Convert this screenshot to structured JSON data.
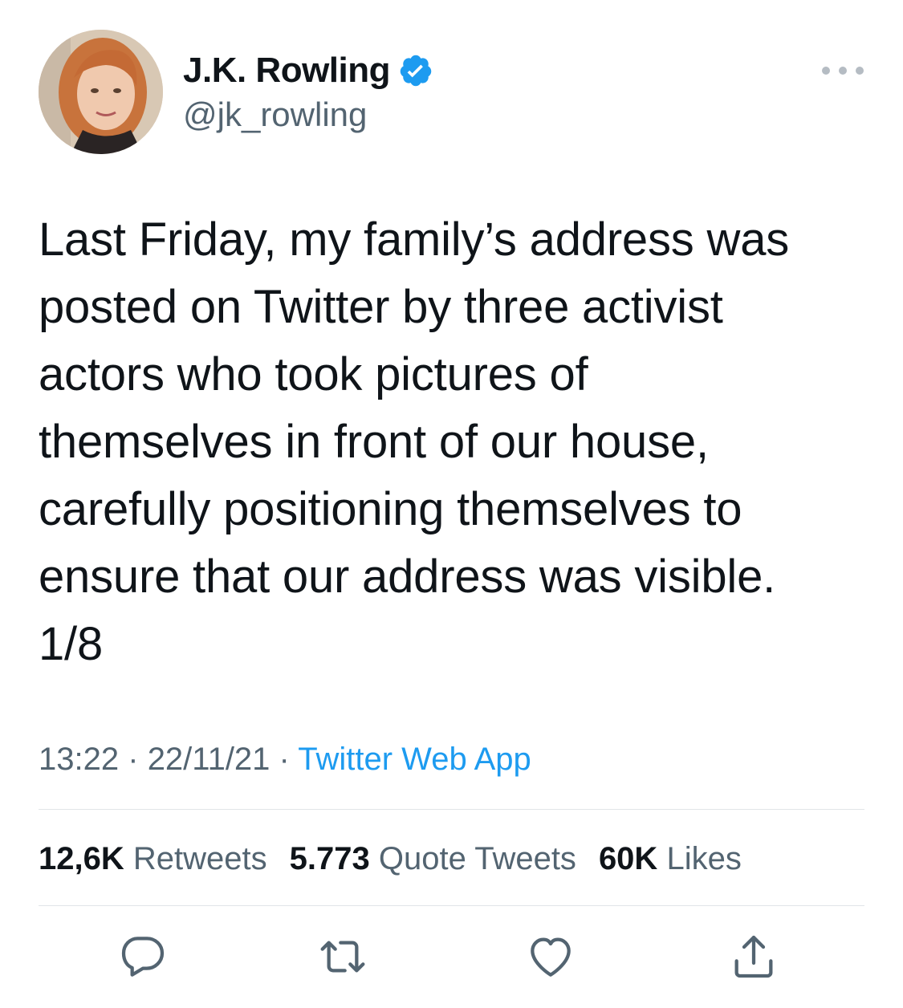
{
  "author": {
    "name": "J.K. Rowling",
    "handle": "@jk_rowling",
    "verified": true,
    "avatar_icon": "profile-photo"
  },
  "tweet": {
    "text_lines": [
      "Last Friday, my family’s address was",
      "posted on Twitter by three activist",
      "actors who took pictures of",
      "themselves in front of our house,",
      "carefully positioning themselves to",
      "ensure that our address was visible.",
      "1/8"
    ],
    "time": "13:22",
    "date": "22/11/21",
    "separator": "·",
    "source": "Twitter Web App"
  },
  "stats": {
    "retweets_count": "12,6K",
    "retweets_label": "Retweets",
    "quotes_count": "5.773",
    "quotes_label": "Quote Tweets",
    "likes_count": "60K",
    "likes_label": "Likes"
  },
  "actions": {
    "reply_icon": "reply-icon",
    "retweet_icon": "retweet-icon",
    "like_icon": "heart-icon",
    "share_icon": "share-icon"
  },
  "colors": {
    "text_primary": "#0f1419",
    "text_secondary": "#536471",
    "accent": "#1d9bf0",
    "divider": "#e1e5e8",
    "verified_badge": "#1d9bf0"
  }
}
